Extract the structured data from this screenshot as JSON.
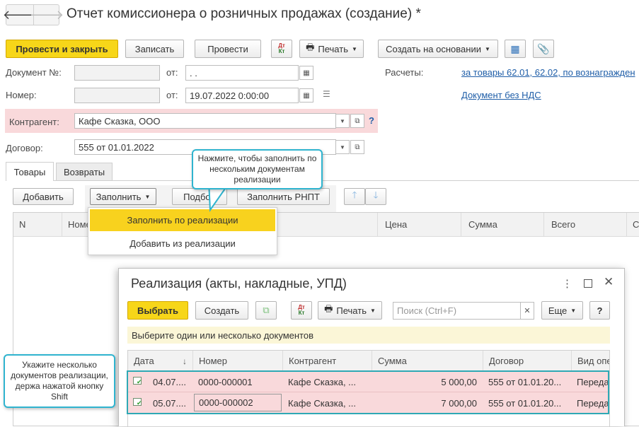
{
  "window": {
    "title": "Отчет комиссионера о розничных продажах (создание) *"
  },
  "toolbar": {
    "post_close": "Провести и закрыть",
    "save": "Записать",
    "post": "Провести",
    "print": "Печать",
    "create_based": "Создать на основании"
  },
  "form": {
    "doc_label": "Документ №:",
    "doc_value": "",
    "from_label": "от:",
    "doc_date_value": " .  .",
    "number_label": "Номер:",
    "number_value": "",
    "from2_label": "от:",
    "date_value": "19.07.2022  0:00:00",
    "settlements_label": "Расчеты:",
    "settlements_link": "за товары 62.01, 62.02, по вознагражден",
    "vat_link": "Документ без НДС",
    "counterparty_label": "Контрагент:",
    "counterparty_value": "Кафе Сказка, ООО",
    "help": "?",
    "contract_label": "Договор:",
    "contract_value": "555 от 01.01.2022"
  },
  "tabs": [
    {
      "label": "Товары"
    },
    {
      "label": "Возвраты"
    }
  ],
  "goods_toolbar": {
    "add": "Добавить",
    "fill": "Заполнить",
    "pick": "Подбор",
    "fill_rnpt": "Заполнить РНПТ"
  },
  "fill_menu": {
    "items": [
      {
        "label": "Заполнить по реализации"
      },
      {
        "label": "Добавить из реализации"
      }
    ]
  },
  "goods_table": {
    "columns": [
      "N",
      "Номе",
      "Цена",
      "Сумма",
      "Всего",
      "С"
    ]
  },
  "tooltip_fill": "Нажмите, чтобы заполнить по нескольким документам реализации",
  "dialog": {
    "title": "Реализация (акты, накладные, УПД)",
    "select": "Выбрать",
    "create": "Создать",
    "print": "Печать",
    "search_placeholder": "Поиск (Ctrl+F)",
    "more": "Еще",
    "help": "?",
    "hint": "Выберите один или несколько документов",
    "columns": [
      "Дата",
      "Номер",
      "Контрагент",
      "Сумма",
      "Договор",
      "Вид опе"
    ],
    "rows": [
      {
        "date": "04.07....",
        "number": "0000-000001",
        "counterparty": "Кафе Сказка, ...",
        "sum": "5 000,00",
        "contract": "555 от 01.01.20...",
        "kind": "Переда"
      },
      {
        "date": "05.07....",
        "number": "0000-000002",
        "counterparty": "Кафе Сказка, ...",
        "sum": "7 000,00",
        "contract": "555 от 01.01.20...",
        "kind": "Переда"
      }
    ]
  },
  "tooltip_shift": "Укажите несколько документов реализации, держа нажатой кнопку Shift",
  "colors": {
    "accent_yellow": "#f7d619",
    "highlight_pink": "#f9d9db",
    "callout_teal": "#2fb4cf",
    "link_blue": "#1f5ea8"
  }
}
